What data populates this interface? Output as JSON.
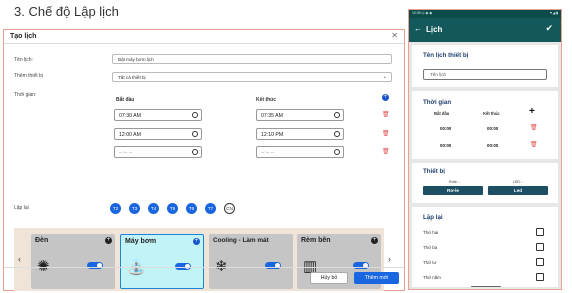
{
  "heading": "3. Chế độ Lập lịch",
  "web": {
    "title": "Tạo lịch",
    "close": "✕",
    "name_label": "Tên lịch:",
    "name_value": "Bật máy bơm lịch",
    "device_label": "Thêm thiết bị",
    "device_value": "Tất cả thiết bị",
    "time_label": "Thời gian:",
    "start_header": "Bắt đầu",
    "end_header": "Kết thúc",
    "rows": [
      {
        "start": "07:30 AM",
        "end": "07:35 AM"
      },
      {
        "start": "12:00 AM",
        "end": "12:10 PM"
      },
      {
        "start": "--:-- --",
        "end": "--:-- --"
      }
    ],
    "repeat_label": "Lặp lại",
    "days": [
      {
        "label": "T2",
        "on": true
      },
      {
        "label": "T3",
        "on": true
      },
      {
        "label": "T4",
        "on": true
      },
      {
        "label": "T5",
        "on": true
      },
      {
        "label": "T6",
        "on": true
      },
      {
        "label": "T7",
        "on": true
      },
      {
        "label": "CN",
        "on": false
      }
    ],
    "devices": [
      {
        "name": "Đèn",
        "icon": "bulb-icon",
        "glyph": "✺",
        "selected": false,
        "on": true
      },
      {
        "name": "Máy bơm",
        "icon": "pump-icon",
        "glyph": "⛲",
        "selected": true,
        "on": true
      },
      {
        "name": "Cooling - Làm mát",
        "icon": "cooling-icon",
        "glyph": "❄",
        "selected": false,
        "on": true
      },
      {
        "name": "Rèm bên",
        "icon": "curtain-icon",
        "glyph": "▥",
        "selected": false,
        "on": true
      }
    ],
    "cancel": "Hủy bỏ",
    "submit": "Thêm mới"
  },
  "mobile": {
    "status": "10:35 ◷ ◉ ◉",
    "status_right": "▼◢ ▮",
    "title": "Lịch",
    "name_section": "Tên lịch thiết bị",
    "name_placeholder": "Tên lịch",
    "time_section": "Thời gian",
    "start_header": "Bắt đầu",
    "end_header": "Kết thúc",
    "rows": [
      {
        "start": "00:00",
        "end": "00:00"
      },
      {
        "start": "00:00",
        "end": "00:00"
      }
    ],
    "device_section": "Thiết bị",
    "devices": [
      {
        "id": "Rơle: -",
        "label": "Rơ-le"
      },
      {
        "id": "LED: -",
        "label": "Led"
      }
    ],
    "repeat_section": "Lặp lại",
    "days": [
      "Thứ hai",
      "Thứ ba",
      "Thứ tư",
      "Thứ năm"
    ]
  }
}
